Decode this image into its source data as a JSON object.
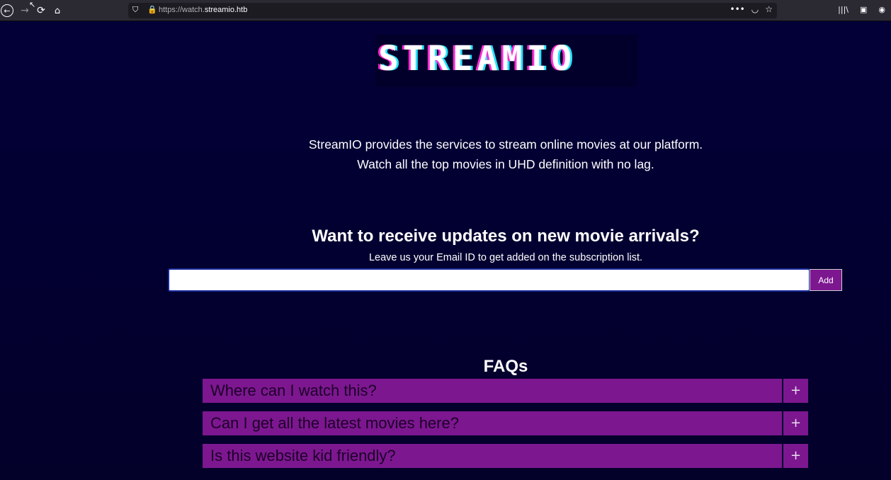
{
  "browser": {
    "url_prefix": "https://watch.",
    "url_host": "streamio.htb",
    "back_icon": "←",
    "forward_icon": "→",
    "reload_icon": "⟳",
    "home_icon": "⌂",
    "shield_icon": "⛉",
    "lock_icon": "🔒",
    "more_icon": "•••",
    "pocket_icon": "◡",
    "star_icon": "☆",
    "library_icon": "|||\\",
    "sidebar_icon": "▣",
    "account_icon": "◉"
  },
  "page": {
    "logo": "STREAMIO",
    "tagline_line1": "StreamIO provides the services to stream online movies at our platform.",
    "tagline_line2": "Watch all the top movies in UHD definition with no lag.",
    "subscribe_title": "Want to receive updates on new movie arrivals?",
    "subscribe_desc": "Leave us your Email ID to get added on the subscription list.",
    "email_value": "",
    "add_label": "Add",
    "faq_title": "FAQs",
    "faqs": [
      {
        "question": "Where can I watch this?",
        "toggle": "+"
      },
      {
        "question": "Can I get all the latest movies here?",
        "toggle": "+"
      },
      {
        "question": "Is this website kid friendly?",
        "toggle": "+"
      }
    ]
  },
  "colors": {
    "background": "#03002e",
    "accent": "#7d1790"
  }
}
